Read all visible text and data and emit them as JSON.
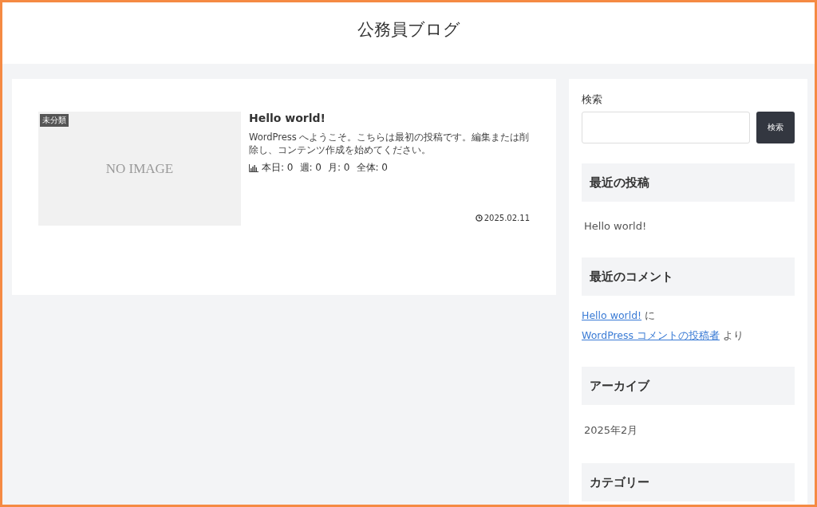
{
  "site_title": "公務員ブログ",
  "posts": [
    {
      "category": "未分類",
      "image_placeholder": "NO IMAGE",
      "title": "Hello world!",
      "excerpt": "WordPress へようこそ。こちらは最初の投稿です。編集または削除し、コンテンツ作成を始めてください。",
      "stats": [
        "本日: 0",
        "週: 0",
        "月: 0",
        "全体: 0"
      ],
      "date": "2025.02.11"
    }
  ],
  "search": {
    "label": "検索",
    "button": "検索"
  },
  "widgets": [
    {
      "title": "最近の投稿",
      "kind": "links",
      "items": [
        "Hello world!"
      ]
    },
    {
      "title": "最近のコメント",
      "kind": "comments",
      "items": [
        {
          "post": "Hello world!",
          "connector": "に",
          "author": "WordPress コメントの投稿者",
          "suffix": "より"
        }
      ]
    },
    {
      "title": "アーカイブ",
      "kind": "links",
      "items": [
        "2025年2月"
      ]
    },
    {
      "title": "カテゴリー",
      "kind": "links"
    }
  ]
}
